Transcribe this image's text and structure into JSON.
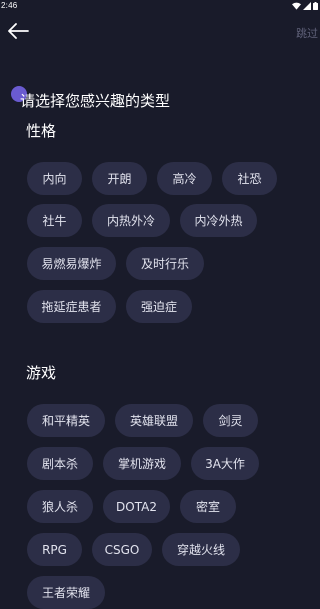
{
  "status_bar": {
    "time": "2:46",
    "icons": [
      "wifi-icon",
      "signal-icon",
      "battery-icon"
    ]
  },
  "top_bar": {
    "back_icon": "arrow-left-icon",
    "skip_label": "跳过"
  },
  "title": "请选择您感兴趣的类型",
  "sections": {
    "personality": {
      "title": "性格",
      "tags": [
        "内向",
        "开朗",
        "高冷",
        "社恐",
        "社牛",
        "内热外冷",
        "内冷外热",
        "易燃易爆炸",
        "及时行乐",
        "拖延症患者",
        "强迫症"
      ]
    },
    "games": {
      "title": "游戏",
      "tags": [
        "和平精英",
        "英雄联盟",
        "剑灵",
        "剧本杀",
        "掌机游戏",
        "3A大作",
        "狼人杀",
        "DOTA2",
        "密室",
        "RPG",
        "CSGO",
        "穿越火线",
        "王者荣耀"
      ]
    }
  },
  "colors": {
    "background": "#191b2a",
    "chip_background": "#2c2e47",
    "chip_text": "#e2e3ee",
    "accent_dot": "#6a5bd0",
    "skip_text": "#5e6078"
  }
}
